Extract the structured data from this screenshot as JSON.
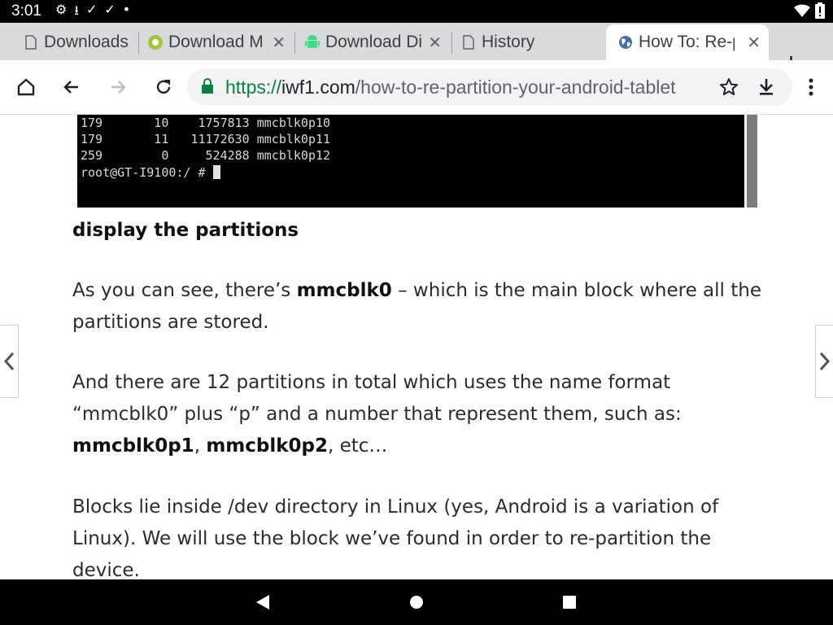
{
  "status": {
    "time": "3:01"
  },
  "tabs": [
    {
      "title": "Downloads",
      "favicon": "page-icon",
      "closable": false
    },
    {
      "title": "Download M",
      "favicon": "android-round-icon",
      "closable": true
    },
    {
      "title": "Download Di",
      "favicon": "android-robot-icon",
      "closable": true
    },
    {
      "title": "History",
      "favicon": "page-icon",
      "closable": false
    },
    {
      "title": "How To: Re-p",
      "favicon": "globe-icon",
      "closable": true,
      "active": true
    }
  ],
  "toolbar": {
    "url_scheme": "https://",
    "url_host": "iwf1.com",
    "url_path": "/how-to-re-partition-your-android-tablet"
  },
  "terminal": {
    "lines": [
      "179       10    1757813 mmcblk0p10",
      "179       11   11172630 mmcblk0p11",
      "259        0     524288 mmcblk0p12"
    ],
    "prompt": "root@GT-I9100:/ # "
  },
  "article": {
    "caption": "display the partitions",
    "p1_a": "As you can see, there’s ",
    "p1_b": "mmcblk0",
    "p1_c": " – which is the main block where all the partitions are stored.",
    "p2_a": "And there are 12 partitions in total which uses the name format “mmcblk0” plus “p” and a number that represent them, such as: ",
    "p2_b": "mmcblk0p1",
    "p2_c": ", ",
    "p2_d": "mmcblk0p2",
    "p2_e": ", etc…",
    "p3": "Blocks lie inside /dev directory in Linux (yes, Android is a variation of Linux). We will use the block we’ve found in order to re-partition the device."
  },
  "colors": {
    "secure_green": "#0b8043",
    "tabstrip": "#d9dadc",
    "omnibox": "#f1f3f4"
  }
}
